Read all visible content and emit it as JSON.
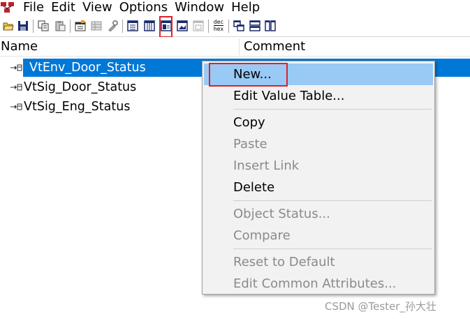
{
  "menubar": {
    "items": [
      "File",
      "Edit",
      "View",
      "Options",
      "Window",
      "Help"
    ]
  },
  "toolbar": {
    "buttons": [
      {
        "name": "open-icon"
      },
      {
        "name": "save-icon"
      },
      {
        "name": "copy-icon"
      },
      {
        "name": "paste-icon"
      },
      {
        "name": "properties-icon"
      },
      {
        "name": "grid-view-icon"
      },
      {
        "name": "tool-icon"
      },
      {
        "name": "table-view-icon"
      },
      {
        "name": "columns-view-icon"
      },
      {
        "name": "value-table-view-icon"
      },
      {
        "name": "image-view-icon"
      },
      {
        "name": "disabled-view-icon"
      },
      {
        "name": "dec-hex-icon",
        "label_top": "dec",
        "label_bottom": "hex"
      },
      {
        "name": "cascade-windows-icon"
      },
      {
        "name": "tile-horizontal-icon"
      },
      {
        "name": "tile-vertical-icon"
      }
    ]
  },
  "list": {
    "columns": [
      "Name",
      "Comment"
    ],
    "rows": [
      {
        "name": "VtEnv_Door_Status",
        "selected": true
      },
      {
        "name": "VtSig_Door_Status",
        "selected": false
      },
      {
        "name": "VtSig_Eng_Status",
        "selected": false
      }
    ]
  },
  "context_menu": {
    "items": [
      {
        "label": "New...",
        "enabled": true,
        "hover": true
      },
      {
        "label": "Edit Value Table...",
        "enabled": true
      },
      {
        "label": "Copy",
        "enabled": true
      },
      {
        "label": "Paste",
        "enabled": false
      },
      {
        "label": "Insert Link",
        "enabled": false
      },
      {
        "label": "Delete",
        "enabled": true
      },
      {
        "label": "Object Status...",
        "enabled": false
      },
      {
        "label": "Compare",
        "enabled": false
      },
      {
        "label": "Reset to Default",
        "enabled": false
      },
      {
        "label": "Edit Common Attributes...",
        "enabled": false
      }
    ]
  },
  "watermark": "CSDN @Tester_孙大壮",
  "colors": {
    "selection": "#0078d7",
    "menu_hover": "#99c9f5",
    "highlight_box": "#e0202a"
  }
}
